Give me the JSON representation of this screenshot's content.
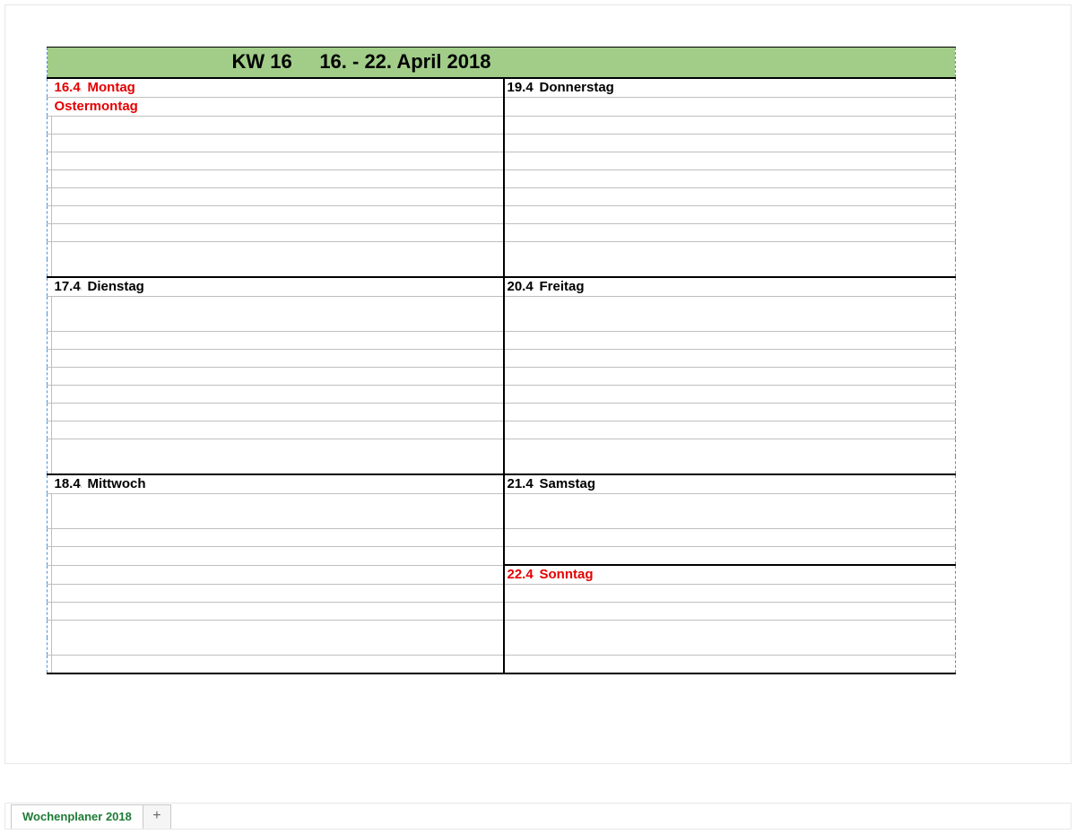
{
  "header": {
    "week_label": "KW 16",
    "date_range": "16. - 22. April 2018"
  },
  "days": {
    "mon": {
      "date": "16.4.",
      "name": "Montag",
      "note": "Ostermontag"
    },
    "tue": {
      "date": "17.4.",
      "name": "Dienstag"
    },
    "wed": {
      "date": "18.4.",
      "name": "Mittwoch"
    },
    "thu": {
      "date": "19.4.",
      "name": "Donnerstag"
    },
    "fri": {
      "date": "20.4.",
      "name": "Freitag"
    },
    "sat": {
      "date": "21.4.",
      "name": "Samstag"
    },
    "sun": {
      "date": "22.4.",
      "name": "Sonntag"
    }
  },
  "tabbar": {
    "active_tab": "Wochenplaner 2018",
    "add_label": "+"
  }
}
